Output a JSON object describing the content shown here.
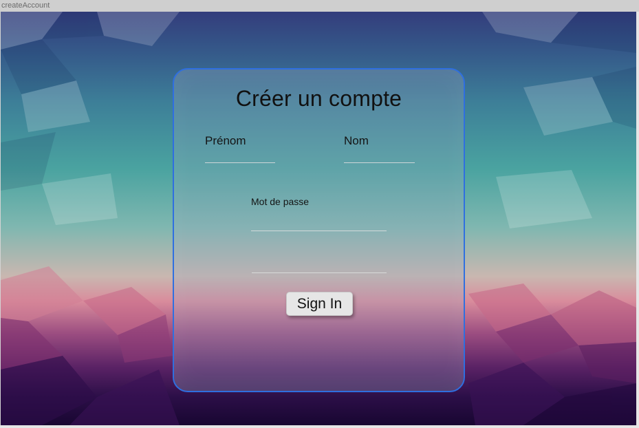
{
  "window": {
    "title": "createAccount"
  },
  "form": {
    "title": "Créer un compte",
    "first_name_label": "Prénom",
    "last_name_label": "Nom",
    "password_label": "Mot de passe",
    "submit_label": "Sign In"
  },
  "colors": {
    "card_border": "#2f6fe0",
    "button_bg": "#e6e6e6"
  }
}
